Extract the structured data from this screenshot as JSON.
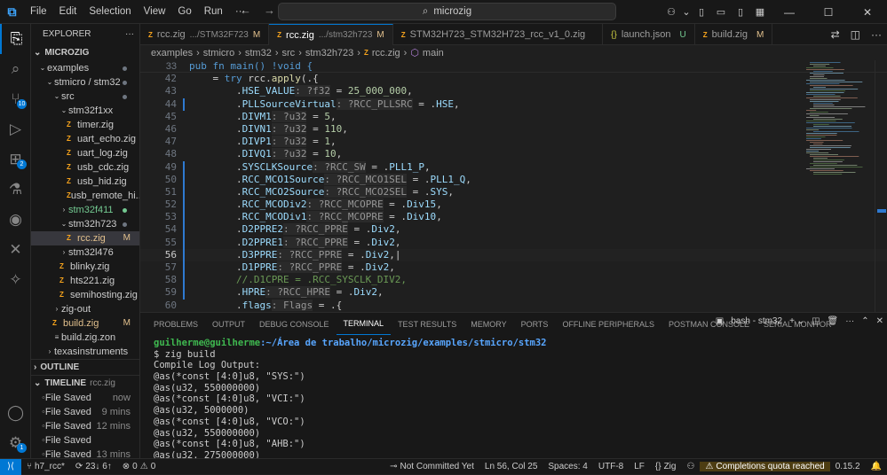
{
  "titlebar": {
    "menus": [
      "File",
      "Edit",
      "Selection",
      "View",
      "Go",
      "Run",
      "···"
    ],
    "search_text": "microzig"
  },
  "activity": {
    "source_control_badge": "10",
    "extensions_badge": "2",
    "settings_badge": "1"
  },
  "sidebar": {
    "title": "EXPLORER",
    "root": "MICROZIG",
    "items": [
      {
        "label": "examples",
        "indent": 0,
        "type": "folder-open",
        "git": "dot"
      },
      {
        "label": "stmicro / stm32",
        "indent": 1,
        "type": "folder-open",
        "git": "dot"
      },
      {
        "label": "src",
        "indent": 2,
        "type": "folder-open",
        "git": "dot"
      },
      {
        "label": "stm32f1xx",
        "indent": 3,
        "type": "folder-open",
        "git": ""
      },
      {
        "label": "timer.zig",
        "indent": 4,
        "type": "zig",
        "git": ""
      },
      {
        "label": "uart_echo.zig",
        "indent": 4,
        "type": "zig",
        "git": ""
      },
      {
        "label": "uart_log.zig",
        "indent": 4,
        "type": "zig",
        "git": ""
      },
      {
        "label": "usb_cdc.zig",
        "indent": 4,
        "type": "zig",
        "git": ""
      },
      {
        "label": "usb_hid.zig",
        "indent": 4,
        "type": "zig",
        "git": ""
      },
      {
        "label": "usb_remote_hi...",
        "indent": 4,
        "type": "zig",
        "git": ""
      },
      {
        "label": "stm32f411",
        "indent": 3,
        "type": "folder",
        "git": "dot-green"
      },
      {
        "label": "stm32h723",
        "indent": 3,
        "type": "folder-open",
        "git": "dot"
      },
      {
        "label": "rcc.zig",
        "indent": 4,
        "type": "zig",
        "git": "M",
        "selected": true
      },
      {
        "label": "stm32l476",
        "indent": 3,
        "type": "folder",
        "git": ""
      },
      {
        "label": "blinky.zig",
        "indent": 3,
        "type": "zig",
        "git": ""
      },
      {
        "label": "hts221.zig",
        "indent": 3,
        "type": "zig",
        "git": ""
      },
      {
        "label": "semihosting.zig",
        "indent": 3,
        "type": "zig",
        "git": ""
      },
      {
        "label": "zig-out",
        "indent": 2,
        "type": "folder",
        "git": ""
      },
      {
        "label": "build.zig",
        "indent": 2,
        "type": "zig",
        "git": "M"
      },
      {
        "label": "build.zig.zon",
        "indent": 2,
        "type": "plain",
        "git": ""
      },
      {
        "label": "texasinstruments",
        "indent": 1,
        "type": "folder",
        "git": ""
      }
    ],
    "outline_label": "OUTLINE",
    "timeline_label": "TIMELINE",
    "timeline_file": "rcc.zig",
    "timeline": [
      {
        "label": "File Saved",
        "time": "now"
      },
      {
        "label": "File Saved",
        "time": "9 mins"
      },
      {
        "label": "File Saved",
        "time": "12 mins"
      },
      {
        "label": "File Saved",
        "time": ""
      },
      {
        "label": "File Saved",
        "time": "13 mins"
      },
      {
        "label": "File Saved",
        "time": "15 mins"
      }
    ]
  },
  "tabs": [
    {
      "name": "rcc.zig",
      "desc": ".../STM32F723",
      "status": "M",
      "active": false,
      "icon": "zig"
    },
    {
      "name": "rcc.zig",
      "desc": ".../stm32h723",
      "status": "M",
      "active": true,
      "icon": "zig"
    },
    {
      "name": "STM32H723_STM32H723_rcc_v1_0.zig",
      "desc": "",
      "status": "",
      "active": false,
      "icon": "zig"
    },
    {
      "name": "launch.json",
      "desc": "",
      "status": "U",
      "active": false,
      "icon": "json"
    },
    {
      "name": "build.zig",
      "desc": "",
      "status": "M",
      "active": false,
      "icon": "zig"
    }
  ],
  "breadcrumb": [
    "examples",
    "stmicro",
    "stm32",
    "src",
    "stm32h723",
    "rcc.zig",
    "main"
  ],
  "editor": {
    "sticky_line_number": "33",
    "sticky_line": "pub fn main() !void {",
    "current_line": "56",
    "lines": [
      {
        "n": "42",
        "html": "    <span class='plain'>= </span><span class='kw'>try</span> <span class='plain'>rcc.</span><span class='fn'>apply</span><span class='plain'>(.{</span>"
      },
      {
        "n": "43",
        "html": "        <span class='plain'>.</span><span class='fld'>HSE_VALUE</span><span class='hint'>: ?f32</span><span class='plain'> = </span><span class='num'>25_000_000</span><span class='plain'>,</span>"
      },
      {
        "n": "44",
        "html": "        <span class='plain'>.</span><span class='fld'>PLLSourceVirtual</span><span class='hint'>: ?RCC_PLLSRC</span><span class='plain'> = .</span><span class='fld'>HSE</span><span class='plain'>,</span>"
      },
      {
        "n": "45",
        "html": "        <span class='plain'>.</span><span class='fld'>DIVM1</span><span class='hint'>: ?u32</span><span class='plain'> = </span><span class='num'>5</span><span class='plain'>,</span>"
      },
      {
        "n": "46",
        "html": "        <span class='plain'>.</span><span class='fld'>DIVN1</span><span class='hint'>: ?u32</span><span class='plain'> = </span><span class='num'>110</span><span class='plain'>,</span>"
      },
      {
        "n": "47",
        "html": "        <span class='plain'>.</span><span class='fld'>DIVP1</span><span class='hint'>: ?u32</span><span class='plain'> = </span><span class='num'>1</span><span class='plain'>,</span>"
      },
      {
        "n": "48",
        "html": "        <span class='plain'>.</span><span class='fld'>DIVQ1</span><span class='hint'>: ?u32</span><span class='plain'> = </span><span class='num'>10</span><span class='plain'>,</span>"
      },
      {
        "n": "49",
        "html": "        <span class='plain'>.</span><span class='fld'>SYSCLKSource</span><span class='hint'>: ?RCC_SW</span><span class='plain'> = .</span><span class='fld'>PLL1_P</span><span class='plain'>,</span>"
      },
      {
        "n": "50",
        "html": "        <span class='plain'>.</span><span class='fld'>RCC_MCO1Source</span><span class='hint'>: ?RCC_MCO1SEL</span><span class='plain'> = .</span><span class='fld'>PLL1_Q</span><span class='plain'>,</span>"
      },
      {
        "n": "51",
        "html": "        <span class='plain'>.</span><span class='fld'>RCC_MCO2Source</span><span class='hint'>: ?RCC_MCO2SEL</span><span class='plain'> = .</span><span class='fld'>SYS</span><span class='plain'>,</span>"
      },
      {
        "n": "52",
        "html": "        <span class='plain'>.</span><span class='fld'>RCC_MCODiv2</span><span class='hint'>: ?RCC_MCOPRE</span><span class='plain'> = .</span><span class='fld'>Div15</span><span class='plain'>,</span>"
      },
      {
        "n": "53",
        "html": "        <span class='plain'>.</span><span class='fld'>RCC_MCODiv1</span><span class='hint'>: ?RCC_MCOPRE</span><span class='plain'> = .</span><span class='fld'>Div10</span><span class='plain'>,</span>"
      },
      {
        "n": "54",
        "html": "        <span class='plain'>.</span><span class='fld'>D2PPRE2</span><span class='hint'>: ?RCC_PPRE</span><span class='plain'> = .</span><span class='fld'>Div2</span><span class='plain'>,</span>"
      },
      {
        "n": "55",
        "html": "        <span class='plain'>.</span><span class='fld'>D2PPRE1</span><span class='hint'>: ?RCC_PPRE</span><span class='plain'> = .</span><span class='fld'>Div2</span><span class='plain'>,</span>"
      },
      {
        "n": "56",
        "html": "        <span class='plain'>.</span><span class='fld'>D3PPRE</span><span class='hint'>: ?RCC_PPRE</span><span class='plain'> = .</span><span class='fld'>Div2</span><span class='plain'>,|</span>"
      },
      {
        "n": "57",
        "html": "        <span class='plain'>.</span><span class='fld'>D1PPRE</span><span class='hint'>: ?RCC_PPRE</span><span class='plain'> = .</span><span class='fld'>Div2</span><span class='plain'>,</span>"
      },
      {
        "n": "58",
        "html": "        <span class='cmt'>//.D1CPRE = .RCC_SYSCLK_DIV2,</span>"
      },
      {
        "n": "59",
        "html": "        <span class='plain'>.</span><span class='fld'>HPRE</span><span class='hint'>: ?RCC_HPRE</span><span class='plain'> = .</span><span class='fld'>Div2</span><span class='plain'>,</span>"
      },
      {
        "n": "60",
        "html": "        <span class='plain'>.</span><span class='fld'>flags</span><span class='hint'>: Flags</span><span class='plain'> = .{</span>"
      }
    ]
  },
  "panel": {
    "tabs": [
      "PROBLEMS",
      "OUTPUT",
      "DEBUG CONSOLE",
      "TERMINAL",
      "TEST RESULTS",
      "MEMORY",
      "PORTS",
      "OFFLINE PERIPHERALS",
      "POSTMAN CONSOLE",
      "SERIAL MONITOR"
    ],
    "active_tab": "TERMINAL",
    "terminal_name": "bash - stm32",
    "prompt_user": "guilherme@guilherme",
    "prompt_path": ":~/Área de trabalho/microzig/examples/stmicro/stm32",
    "lines": [
      "$ zig build",
      "Compile Log Output:",
      "@as(*const [4:0]u8, \"SYS:\")",
      "@as(u32, 550000000)",
      "@as(*const [4:0]u8, \"VCI:\")",
      "@as(u32, 5000000)",
      "@as(*const [4:0]u8, \"VCO:\")",
      "@as(u32, 550000000)",
      "@as(*const [4:0]u8, \"AHB:\")",
      "@as(u32, 275000000)"
    ]
  },
  "statusbar": {
    "branch": "h7_rcc*",
    "sync": "23↓ 6↑",
    "errors": "0",
    "warnings": "0",
    "not_committed": "Not Committed Yet",
    "cursor": "Ln 56, Col 25",
    "spaces": "Spaces: 4",
    "encoding": "UTF-8",
    "eol": "LF",
    "language": "Zig",
    "quota": "Completions quota reached",
    "version": "0.15.2"
  },
  "colors": {
    "accent": "#0078d4",
    "zig": "#f7a41d",
    "modified": "#e2c08d",
    "untracked": "#73c991"
  }
}
